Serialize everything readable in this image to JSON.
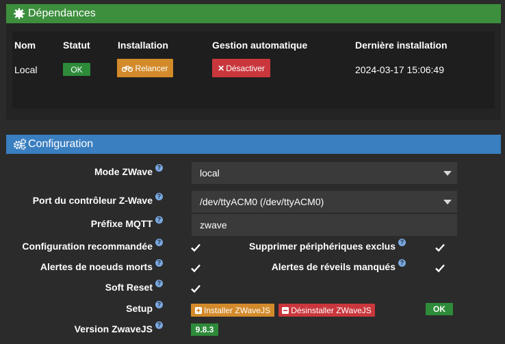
{
  "dependencies": {
    "title": "Dépendances",
    "columns": [
      "Nom",
      "Statut",
      "Installation",
      "Gestion automatique",
      "Dernière installation"
    ],
    "row": {
      "name": "Local",
      "status": "OK",
      "install_button": "Relancer",
      "auto_button": "Désactiver",
      "last_install": "2024-03-17 15:06:49"
    }
  },
  "configuration": {
    "title": "Configuration",
    "mode": {
      "label": "Mode ZWave",
      "value": "local"
    },
    "port": {
      "label": "Port du contrôleur Z-Wave",
      "value": "/dev/ttyACM0 (/dev/ttyACM0)"
    },
    "prefix": {
      "label": "Préfixe MQTT",
      "value": "zwave"
    },
    "recommended": {
      "label": "Configuration recommandée",
      "checked": true
    },
    "delete_excluded": {
      "label": "Supprimer périphériques exclus",
      "checked": true
    },
    "dead_alerts": {
      "label": "Alertes de noeuds morts",
      "checked": true
    },
    "missed_wakeup": {
      "label": "Alertes de réveils manqués",
      "checked": true
    },
    "soft_reset": {
      "label": "Soft Reset",
      "checked": true
    },
    "setup": {
      "label": "Setup",
      "install_button": "Installer ZWaveJS",
      "uninstall_button": "Désinstaller ZWaveJS",
      "status": "OK"
    },
    "version": {
      "label": "Version ZwaveJS",
      "value": "9.8.3"
    }
  },
  "colors": {
    "dependencies_header": "#3d8f3d",
    "configuration_header": "#3a7fc0",
    "ok_green": "#2e8b3a",
    "orange": "#d38a2a",
    "red": "#c9373d"
  },
  "icons": {
    "dependencies_header": "puzzle-gear-icon",
    "configuration_header": "gears-icon",
    "relaunch": "bicycle-icon",
    "deactivate": "close-icon",
    "install": "plus-square-icon",
    "uninstall": "minus-square-icon",
    "help": "question-circle-icon",
    "check": "check-icon",
    "select": "caret-down-icon"
  }
}
